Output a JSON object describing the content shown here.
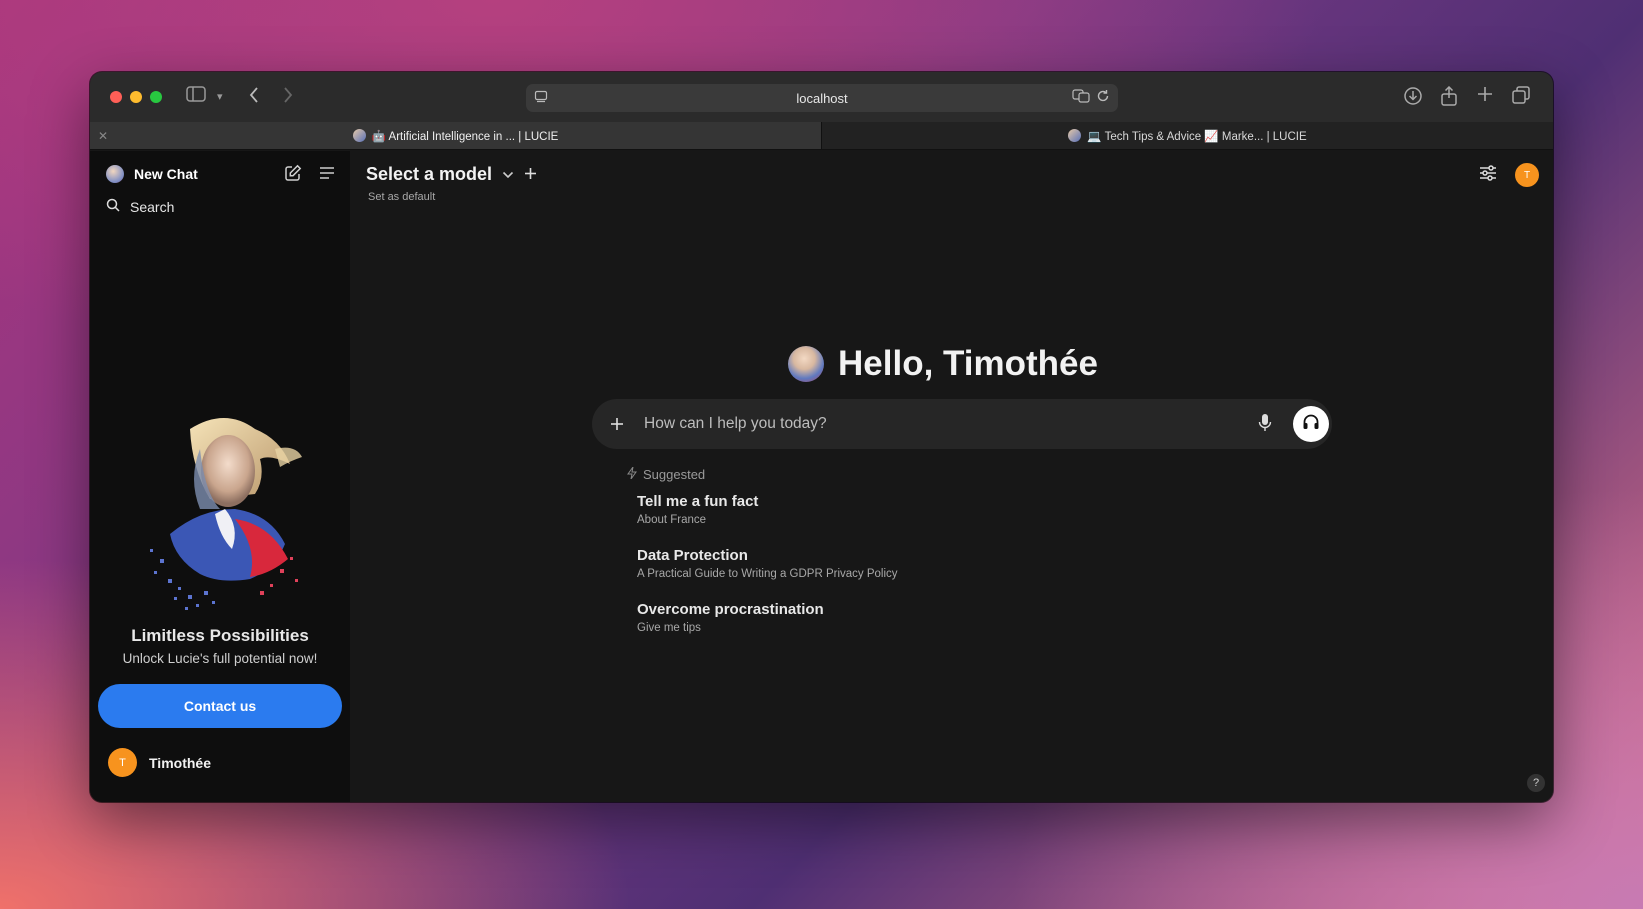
{
  "browser": {
    "url": "localhost",
    "tabs": [
      {
        "label": "🤖 Artificial Intelligence in ... | LUCIE",
        "active": true
      },
      {
        "label": "💻 Tech Tips & Advice 📈 Marke... | LUCIE",
        "active": false
      }
    ]
  },
  "sidebar": {
    "title": "New Chat",
    "search_label": "Search",
    "promo_title": "Limitless Possibilities",
    "promo_subtitle": "Unlock Lucie's full potential now!",
    "contact_label": "Contact us",
    "user_initial": "T",
    "user_name": "Timothée"
  },
  "header": {
    "model_select_label": "Select a model",
    "set_default_label": "Set as default",
    "avatar_initial": "T"
  },
  "main": {
    "greeting": "Hello, Timothée",
    "prompt_placeholder": "How can I help you today?",
    "suggested_label": "Suggested",
    "suggestions": [
      {
        "title": "Tell me a fun fact",
        "subtitle": "About France"
      },
      {
        "title": "Data Protection",
        "subtitle": "A Practical Guide to Writing a GDPR Privacy Policy"
      },
      {
        "title": "Overcome procrastination",
        "subtitle": "Give me tips"
      }
    ],
    "help_label": "?"
  },
  "icons": [
    "sidebar-toggle-icon",
    "chevron-down-icon",
    "back-icon",
    "forward-icon",
    "reader-icon",
    "translate-icon",
    "reload-icon",
    "download-icon",
    "share-icon",
    "new-tab-icon",
    "tabs-overview-icon",
    "compose-icon",
    "menu-icon",
    "search-icon",
    "settings-sliders-icon",
    "plus-icon",
    "mic-icon",
    "headphones-icon",
    "sparkle-icon"
  ],
  "colors": {
    "accent": "#2b7bef",
    "avatar": "#f7931e",
    "background": "#171717",
    "sidebar": "#0e0e0e"
  }
}
